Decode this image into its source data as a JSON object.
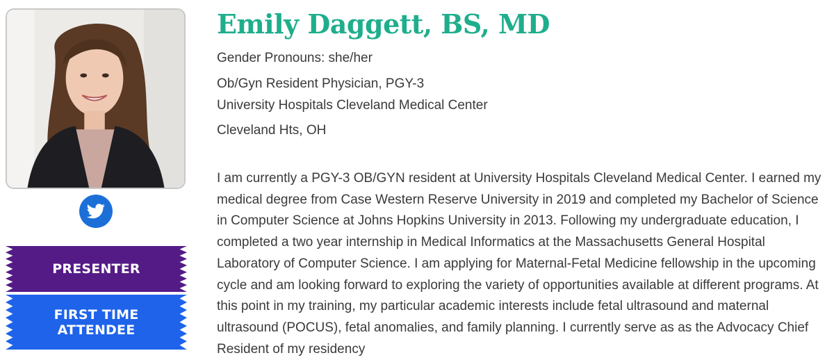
{
  "profile": {
    "name": "Emily Daggett, BS, MD",
    "pronouns": "Gender Pronouns: she/her",
    "title": "Ob/Gyn Resident Physician, PGY-3",
    "institution": "University Hospitals Cleveland Medical Center",
    "location": "Cleveland Hts, OH",
    "bio": "I am currently a PGY-3 OB/GYN resident at University Hospitals Cleveland Medical Center. I earned my medical degree from Case Western Reserve University in 2019 and completed my Bachelor of Science in Computer Science at Johns Hopkins University in 2013. Following my undergraduate education, I completed a two year internship in Medical Informatics at the Massachusetts General Hospital Laboratory of Computer Science. I am applying for Maternal-Fetal Medicine fellowship in the upcoming cycle and am looking forward to exploring the variety of opportunities available at different programs. At this point in my training, my particular academic interests include fetal ultrasound and maternal ultrasound (POCUS), fetal anomalies, and family planning. I currently serve as as the Advocacy Chief Resident of my residency"
  },
  "social": {
    "icon": "twitter-icon",
    "color": "#1d6fd8"
  },
  "badges": {
    "presenter": {
      "label": "PRESENTER",
      "color": "#541b86"
    },
    "first_time": {
      "line1": "FIRST TIME",
      "line2": "ATTENDEE",
      "color": "#1e63ea"
    }
  },
  "colors": {
    "name": "#1fae8c",
    "text": "#3a3a3a"
  }
}
